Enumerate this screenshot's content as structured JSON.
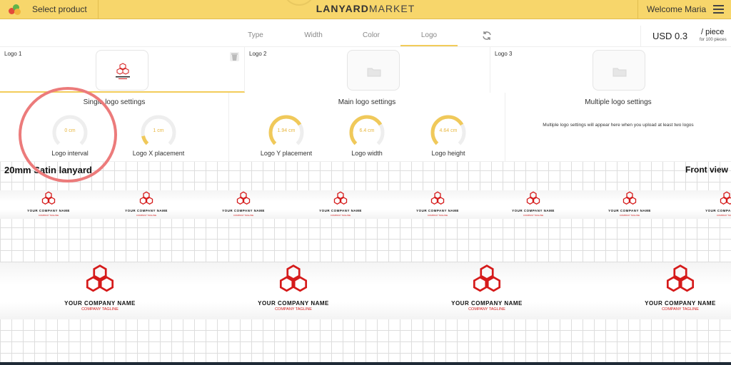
{
  "header": {
    "select_product": "Select product",
    "brand_bold": "LANYARD",
    "brand_light": "MARKET",
    "welcome": "Welcome Maria"
  },
  "tabs": [
    {
      "label": "Type"
    },
    {
      "label": "Width"
    },
    {
      "label": "Color"
    },
    {
      "label": "Logo"
    }
  ],
  "active_tab": "Logo",
  "price": {
    "amount": "USD 0.3",
    "unit": "/ piece",
    "note": "for 100 pieces"
  },
  "logo_slots": [
    {
      "label": "Logo 1"
    },
    {
      "label": "Logo 2"
    },
    {
      "label": "Logo 3"
    }
  ],
  "single_logo_settings": {
    "title": "Single logo settings",
    "gauges": [
      {
        "value": "0 cm",
        "label": "Logo interval",
        "fill": 0.0
      },
      {
        "value": "1 cm",
        "label": "Logo X placement",
        "fill": 0.12
      }
    ]
  },
  "main_logo_settings": {
    "title": "Main logo settings",
    "gauges": [
      {
        "value": "1.94 cm",
        "label": "Logo Y placement",
        "fill": 0.72
      },
      {
        "value": "6.4 cm",
        "label": "Logo width",
        "fill": 0.72
      },
      {
        "value": "4.64 cm",
        "label": "Logo height",
        "fill": 0.72
      }
    ]
  },
  "multiple_logo_settings": {
    "title": "Multiple logo settings",
    "note": "Multiple logo settings will appear here when you upload at least two logos"
  },
  "preview": {
    "title": "20mm Satin lanyard",
    "view": "Front view",
    "company": "YOUR COMPANY NAME",
    "tagline": "COMPANY TAGLINE"
  },
  "colors": {
    "accent": "#f2cc5a",
    "header_bg": "#f7d66b",
    "gauge_fill": "#f0c95a",
    "logo_red": "#d51a1a",
    "highlight": "#ec7b7b"
  }
}
